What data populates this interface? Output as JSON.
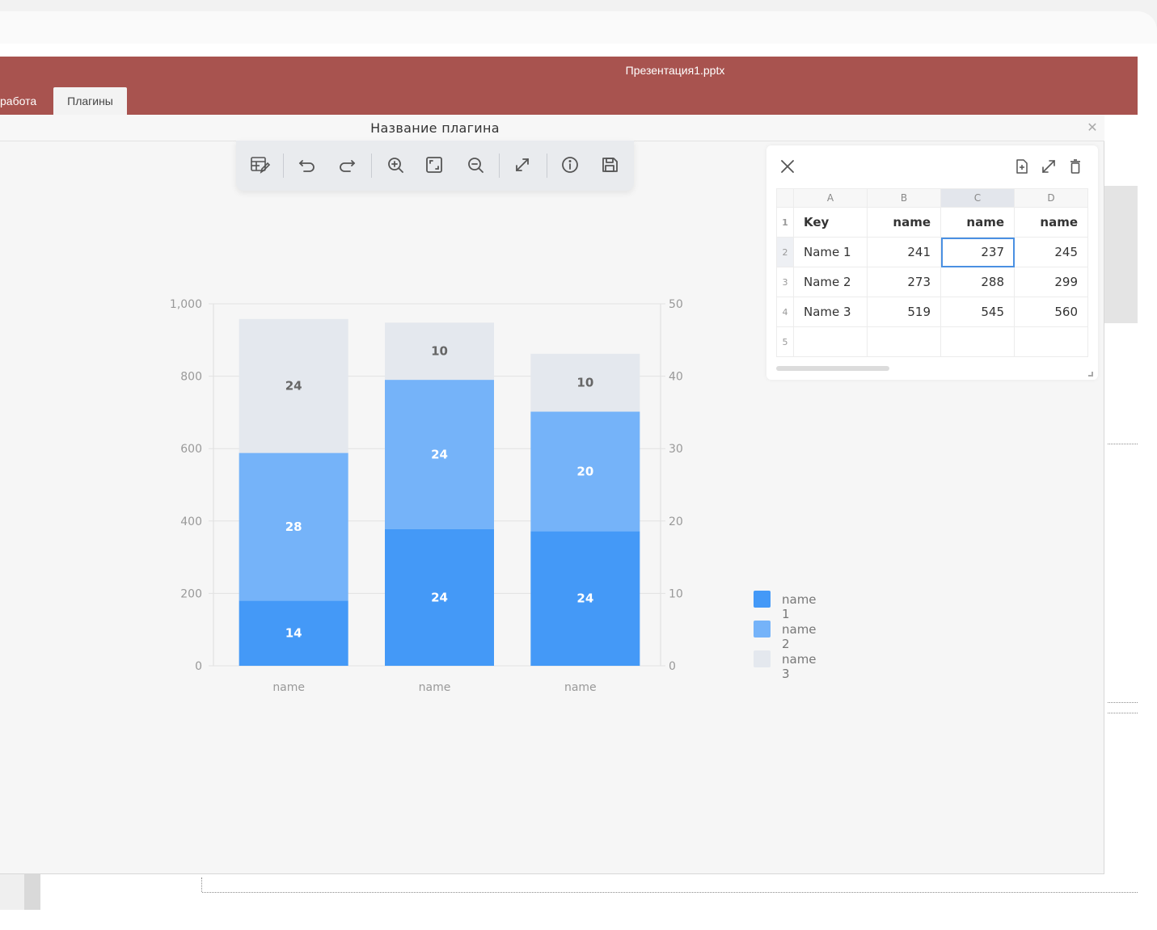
{
  "app": {
    "window_title": "Презентация1.pptx",
    "tabs": [
      {
        "label": "работа",
        "active": false
      },
      {
        "label": "Плагины",
        "active": true
      }
    ],
    "header_color": "#a8534f"
  },
  "dialog": {
    "title": "Название плагина",
    "close_icon": "close-icon"
  },
  "toolbar": {
    "buttons": [
      {
        "name": "edit-data-button",
        "icon": "table-edit-icon"
      },
      {
        "name": "undo-button",
        "icon": "undo-icon"
      },
      {
        "name": "redo-button",
        "icon": "redo-icon"
      },
      {
        "name": "zoom-in-button",
        "icon": "zoom-in-icon"
      },
      {
        "name": "fit-button",
        "icon": "fit-frame-icon"
      },
      {
        "name": "zoom-out-button",
        "icon": "zoom-out-icon"
      },
      {
        "name": "expand-button",
        "icon": "expand-icon"
      },
      {
        "name": "info-button",
        "icon": "info-icon"
      },
      {
        "name": "save-button",
        "icon": "save-icon"
      }
    ]
  },
  "chart_data": {
    "type": "bar",
    "stacked": true,
    "categories": [
      "name",
      "name",
      "name"
    ],
    "series": [
      {
        "name": "name 1",
        "color": "#4499f7",
        "values": [
          180,
          378,
          372
        ],
        "labels": [
          "14",
          "24",
          "24"
        ]
      },
      {
        "name": "name 2",
        "color": "#75b3f9",
        "values": [
          408,
          412,
          330
        ],
        "labels": [
          "28",
          "24",
          "20"
        ]
      },
      {
        "name": "name 3",
        "color": "#e4e8ee",
        "values": [
          370,
          158,
          160
        ],
        "labels": [
          "24",
          "10",
          "10"
        ]
      }
    ],
    "ylim": [
      0,
      1000
    ],
    "yticks": [
      "0",
      "200",
      "400",
      "600",
      "800",
      "1,000"
    ],
    "y2lim": [
      0,
      50
    ],
    "y2ticks": [
      "0",
      "10",
      "20",
      "30",
      "40",
      "50"
    ],
    "grid": true,
    "legend_position": "right"
  },
  "sheet": {
    "columns": [
      "A",
      "B",
      "C",
      "D"
    ],
    "selected_column": "C",
    "rows": [
      {
        "n": "1",
        "cells": [
          "Key",
          "name",
          "name",
          "name"
        ],
        "header": true
      },
      {
        "n": "2",
        "cells": [
          "Name 1",
          "241",
          "237",
          "245"
        ],
        "header": false
      },
      {
        "n": "3",
        "cells": [
          "Name 2",
          "273",
          "288",
          "299"
        ],
        "header": false
      },
      {
        "n": "4",
        "cells": [
          "Name 3",
          "519",
          "545",
          "560"
        ],
        "header": false
      },
      {
        "n": "5",
        "cells": [
          "",
          "",
          "",
          ""
        ],
        "header": false
      }
    ],
    "active_cell": "C2",
    "icons": [
      "add-file-icon",
      "expand-icon",
      "trash-icon"
    ]
  }
}
